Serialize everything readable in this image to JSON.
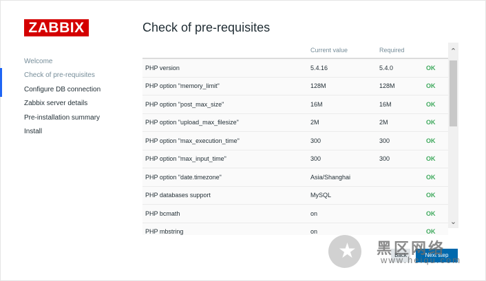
{
  "logo": "ZABBIX",
  "page_title": "Check of pre-requisites",
  "nav": [
    {
      "label": "Welcome"
    },
    {
      "label": "Check of pre-requisites"
    },
    {
      "label": "Configure DB connection"
    },
    {
      "label": "Zabbix server details"
    },
    {
      "label": "Pre-installation summary"
    },
    {
      "label": "Install"
    }
  ],
  "table": {
    "headers": [
      "",
      "Current value",
      "Required",
      ""
    ],
    "rows": [
      {
        "name": "PHP version",
        "current": "5.4.16",
        "required": "5.4.0",
        "status": "OK"
      },
      {
        "name": "PHP option \"memory_limit\"",
        "current": "128M",
        "required": "128M",
        "status": "OK"
      },
      {
        "name": "PHP option \"post_max_size\"",
        "current": "16M",
        "required": "16M",
        "status": "OK"
      },
      {
        "name": "PHP option \"upload_max_filesize\"",
        "current": "2M",
        "required": "2M",
        "status": "OK"
      },
      {
        "name": "PHP option \"max_execution_time\"",
        "current": "300",
        "required": "300",
        "status": "OK"
      },
      {
        "name": "PHP option \"max_input_time\"",
        "current": "300",
        "required": "300",
        "status": "OK"
      },
      {
        "name": "PHP option \"date.timezone\"",
        "current": "Asia/Shanghai",
        "required": "",
        "status": "OK"
      },
      {
        "name": "PHP databases support",
        "current": "MySQL",
        "required": "",
        "status": "OK"
      },
      {
        "name": "PHP bcmath",
        "current": "on",
        "required": "",
        "status": "OK"
      },
      {
        "name": "PHP mbstring",
        "current": "on",
        "required": "",
        "status": "OK"
      }
    ]
  },
  "buttons": {
    "back": "Back",
    "next": "Next step"
  },
  "watermark": {
    "cn": "黑区网络",
    "url": "www.heiqu.com"
  },
  "colors": {
    "brand": "#d40000",
    "ok": "#3ea95c",
    "primary": "#0069ad",
    "nav_active": "#1f65f4"
  }
}
